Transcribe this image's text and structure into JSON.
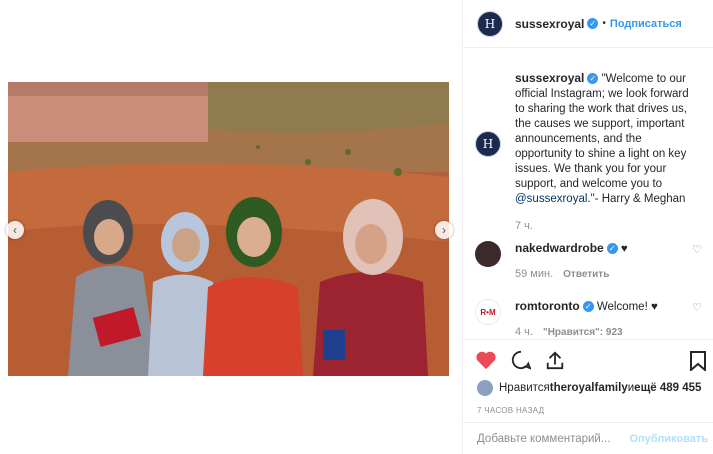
{
  "post": {
    "username": "sussexroyal",
    "follow_label": "Подписаться",
    "avatar_letter": "H"
  },
  "caption": {
    "username": "sussexroyal",
    "text_before": " \"Welcome to our official Instagram; we look forward to sharing the work that drives us, the causes we support, important announcements, and the opportunity to shine a light on key issues. We thank you for your support, and welcome you to ",
    "mention": "@sussexroyal",
    "text_after": ".\"- Harry & Meghan",
    "time": "7 ч."
  },
  "comments": [
    {
      "username": "nakedwardrobe",
      "text": " ♥",
      "time": "59 мин.",
      "reply_label": "Ответить"
    },
    {
      "username": "romtoronto",
      "text": " Welcome! ♥",
      "time": "4 ч.",
      "likes": "\"Нравится\": 923",
      "avatar_text": "R•M"
    }
  ],
  "likes": {
    "prefix": "Нравится ",
    "user": "theroyalfamily",
    "middle": " и ",
    "count": "ещё 489 455"
  },
  "timestamp": "7 ЧАСОВ НАЗАД",
  "comment_box": {
    "placeholder": "Добавьте комментарий...",
    "publish_label": "Опубликовать"
  },
  "colors": {
    "accent": "#3897f0",
    "like_red": "#ed4956",
    "muted": "#8e8e8e"
  },
  "icons": [
    "chevron-left-icon",
    "chevron-right-icon",
    "heart-icon",
    "comment-icon",
    "share-icon",
    "bookmark-icon",
    "verified-icon"
  ]
}
